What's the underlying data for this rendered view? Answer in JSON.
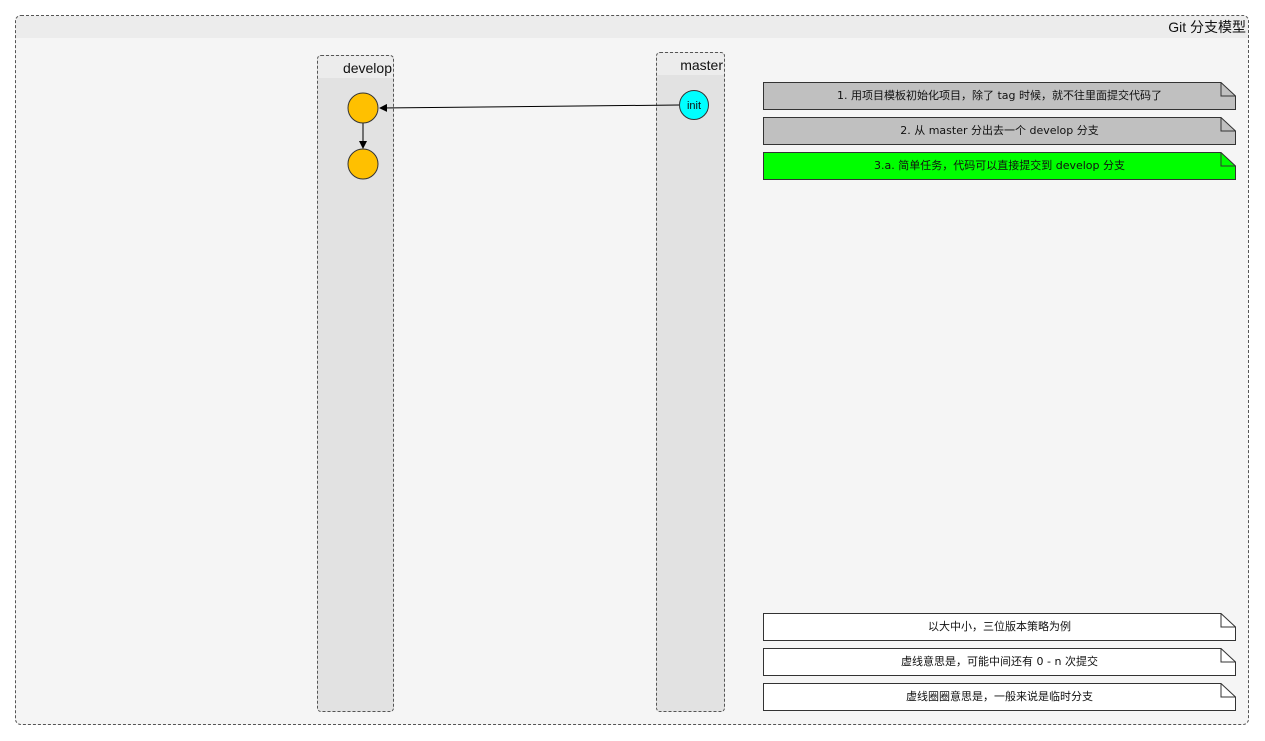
{
  "diagram": {
    "title": "Git 分支模型",
    "lanes": {
      "develop": {
        "label": "develop"
      },
      "master": {
        "label": "master"
      }
    },
    "nodes": {
      "init": {
        "label": "init",
        "color": "#00ffff"
      },
      "develop_commit_1": {
        "color": "#ffc000"
      },
      "develop_commit_2": {
        "color": "#ffc000"
      }
    },
    "notes_top": [
      {
        "text": "1. 用项目模板初始化项目，除了 tag 时候，就不往里面提交代码了",
        "fill": "#c0c0c0"
      },
      {
        "text": "2. 从 master 分出去一个 develop 分支",
        "fill": "#c0c0c0"
      },
      {
        "text": "3.a. 简单任务，代码可以直接提交到 develop 分支",
        "fill": "#00ff00"
      }
    ],
    "notes_bottom": [
      {
        "text": "以大中小，三位版本策略为例",
        "fill": "#ffffff"
      },
      {
        "text": "虚线意思是，可能中间还有 0 - n 次提交",
        "fill": "#ffffff"
      },
      {
        "text": "虚线圈圈意思是，一般来说是临时分支",
        "fill": "#ffffff"
      }
    ]
  }
}
